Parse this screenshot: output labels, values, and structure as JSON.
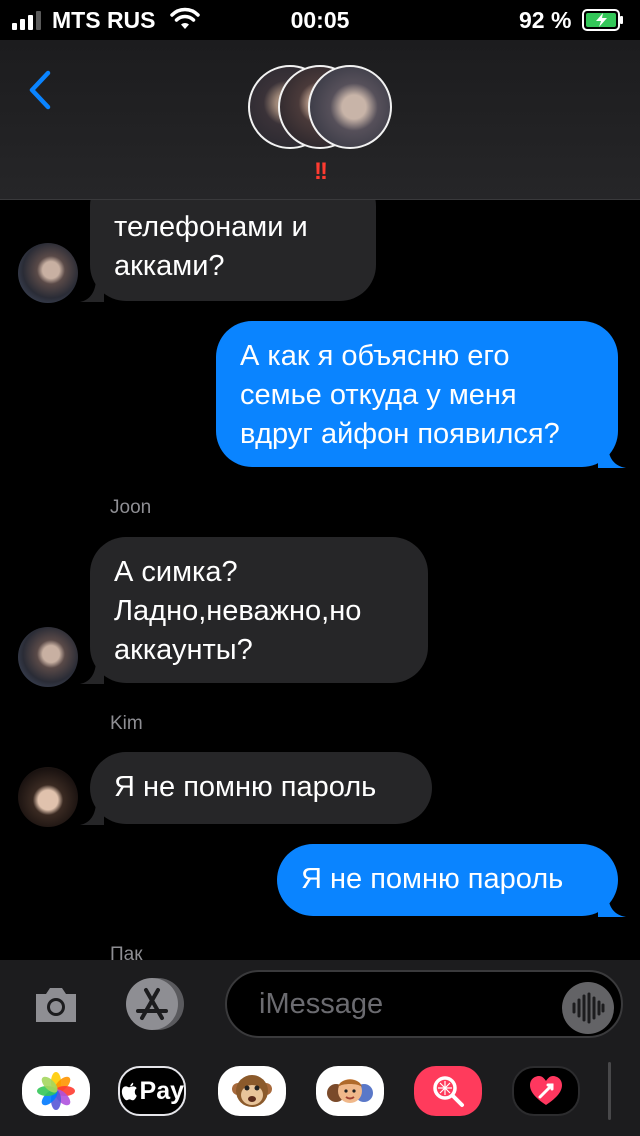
{
  "status_bar": {
    "carrier": "MTS RUS",
    "time": "00:05",
    "battery_percent": "92 %",
    "signal_bars": 3,
    "battery_charging": true
  },
  "header": {
    "alert_mark": "!!"
  },
  "messages": [
    {
      "direction": "incoming",
      "sender": "Joon",
      "lines": [
        "телефонами и",
        "акками?"
      ]
    },
    {
      "direction": "outgoing",
      "lines": [
        "А как я объясню его",
        "семье откуда у меня",
        "вдруг айфон появился?"
      ]
    },
    {
      "direction": "incoming",
      "sender_label": "Joon",
      "lines": [
        "А симка?",
        "Ладно,неважно,но",
        "аккаунты?"
      ]
    },
    {
      "direction": "incoming",
      "sender_label": "Kim",
      "lines": [
        "Я не помню пароль"
      ]
    },
    {
      "direction": "outgoing",
      "lines": [
        "Я не помню пароль"
      ]
    },
    {
      "direction": "incoming",
      "sender_label": "Пак",
      "lines": []
    }
  ],
  "composer": {
    "placeholder": "iMessage"
  },
  "app_drawer": {
    "apps": [
      "photos-icon",
      "apple-pay-icon",
      "animoji-monkey-icon",
      "memoji-icon",
      "image-search-icon",
      "digital-touch-icon"
    ],
    "apple_pay_label": "Pay"
  },
  "colors": {
    "sent_bubble": "#0a84ff",
    "received_bubble": "#262628",
    "accent": "#0a84ff",
    "alert": "#ff3b30"
  }
}
